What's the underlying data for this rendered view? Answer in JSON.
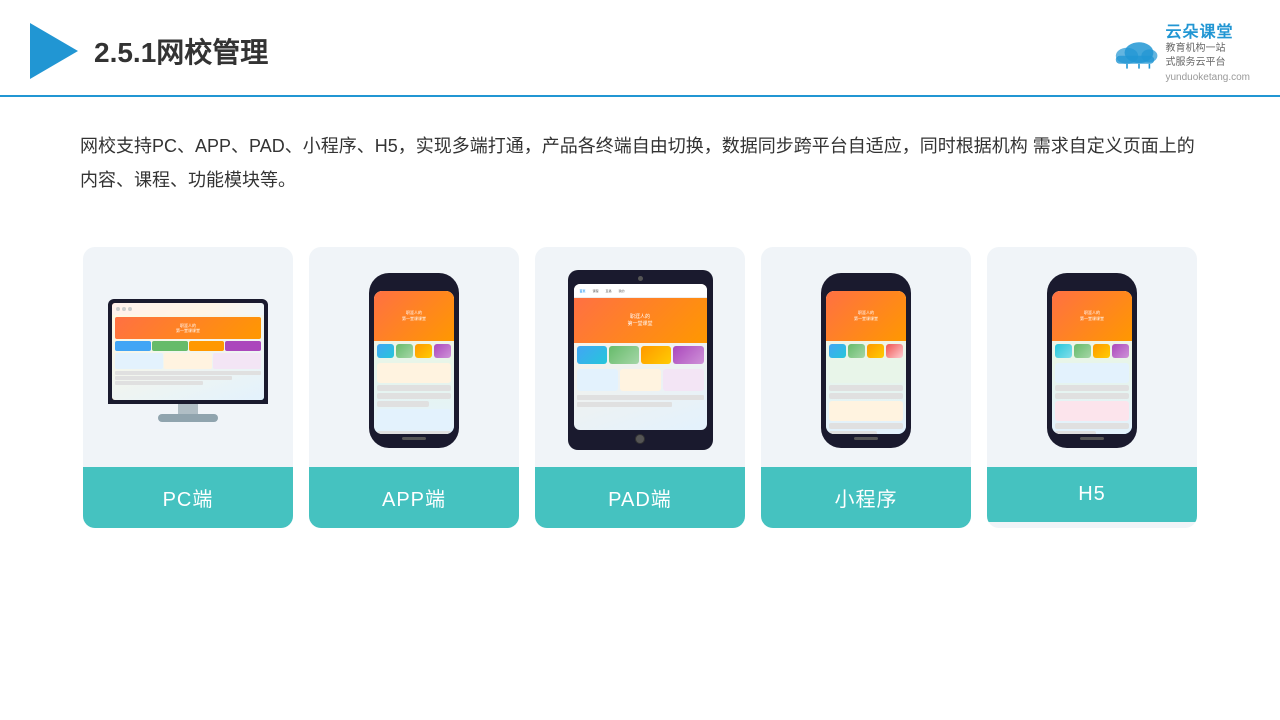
{
  "header": {
    "title": "2.5.1网校管理",
    "brand": {
      "name": "云朵课堂",
      "url": "yunduoketang.com",
      "tagline1": "教育机构一站",
      "tagline2": "式服务云平台"
    }
  },
  "description": "网校支持PC、APP、PAD、小程序、H5，实现多端打通，产品各终端自由切换，数据同步跨平台自适应，同时根据机构\n需求自定义页面上的内容、课程、功能模块等。",
  "cards": [
    {
      "id": "pc",
      "label": "PC端"
    },
    {
      "id": "app",
      "label": "APP端"
    },
    {
      "id": "pad",
      "label": "PAD端"
    },
    {
      "id": "miniapp",
      "label": "小程序"
    },
    {
      "id": "h5",
      "label": "H5"
    }
  ],
  "colors": {
    "accent": "#2196d3",
    "card_bg": "#f0f4f8",
    "label_bg": "#45c2c0",
    "phone_screen_color1": "#ff7043",
    "phone_screen_color2": "#ff9800"
  }
}
